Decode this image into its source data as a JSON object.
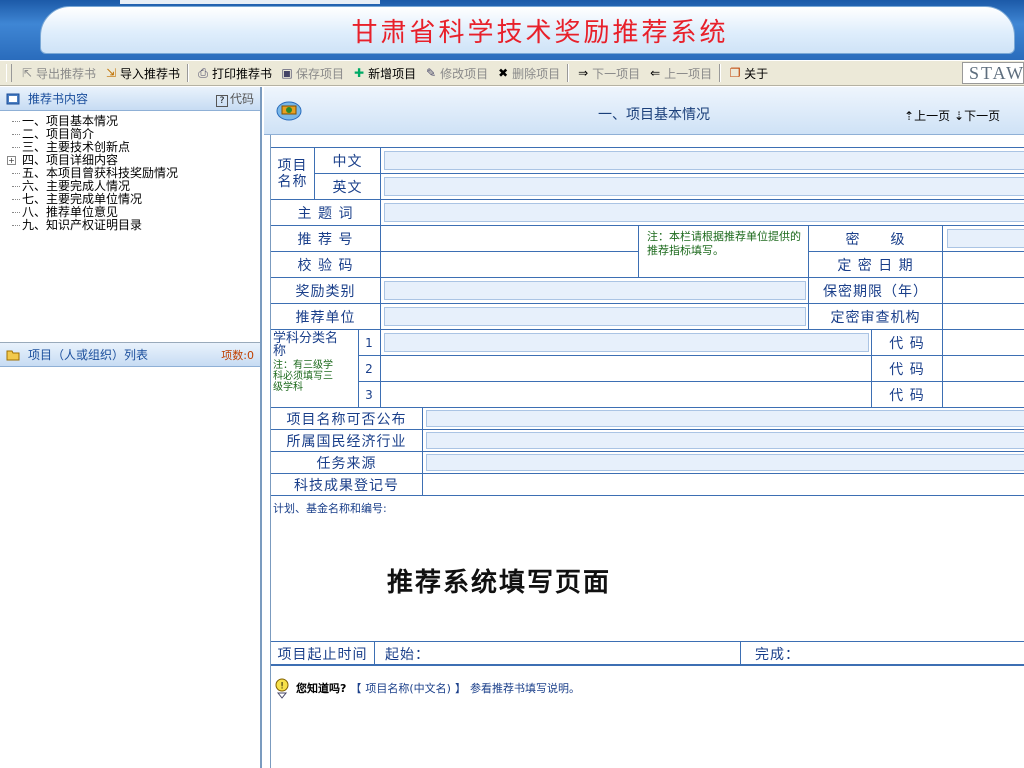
{
  "app": {
    "title": "甘肃省科学技术奖励推荐系统"
  },
  "toolbar": {
    "export": "导出推荐书",
    "import": "导入推荐书",
    "print": "打印推荐书",
    "save": "保存项目",
    "new": "新增项目",
    "edit": "修改项目",
    "delete": "删除项目",
    "next": "下一项目",
    "prev": "上一项目",
    "about": "关于",
    "brand": "STAW"
  },
  "left": {
    "tree_title": "推荐书内容",
    "code_label": "代码",
    "tree": [
      "一、项目基本情况",
      "二、项目简介",
      "三、主要技术创新点",
      "四、项目详细内容",
      "五、本项目曾获科技奖励情况",
      "六、主要完成人情况",
      "七、主要完成单位情况",
      "八、推荐单位意见",
      "九、知识产权证明目录"
    ],
    "list_title": "项目（人或组织）列表",
    "count_label": "项数:0"
  },
  "right": {
    "section_title": "一、项目基本情况",
    "prev_page": "上一页",
    "next_page": "下一页"
  },
  "form": {
    "project_name": "项目\n名称",
    "chinese": "中文",
    "english": "英文",
    "keywords": "主 题 词",
    "recommend_no": "推 荐 号",
    "check_code": "校 验 码",
    "note_recommend": "注：本栏请根据推荐单位提供的推荐指标填写。",
    "secret_level": "密　　级",
    "secret_date": "定 密 日 期",
    "award_category": "奖励类别",
    "secret_period": "保密期限（年）",
    "recommend_unit": "推荐单位",
    "secret_org": "定密审查机构",
    "discipline": "学科分类名称",
    "discipline_note": "注：有三级学科必须填写三级学科",
    "row1": "1",
    "row2": "2",
    "row3": "3",
    "code": "代 码",
    "public": "项目名称可否公布",
    "industry": "所属国民经济行业",
    "task_source": "任务来源",
    "achievement_no": "科技成果登记号",
    "plan_label": "计划、基金名称和编号:",
    "overlay": "推荐系统填写页面",
    "period": "项目起止时间",
    "start": "起始：",
    "end": "完成："
  },
  "tip": {
    "q": "您知道吗?",
    "bracket_l": "【",
    "item": "项目名称(中文名)",
    "bracket_r": "】",
    "text": "参看推荐书填写说明。"
  }
}
